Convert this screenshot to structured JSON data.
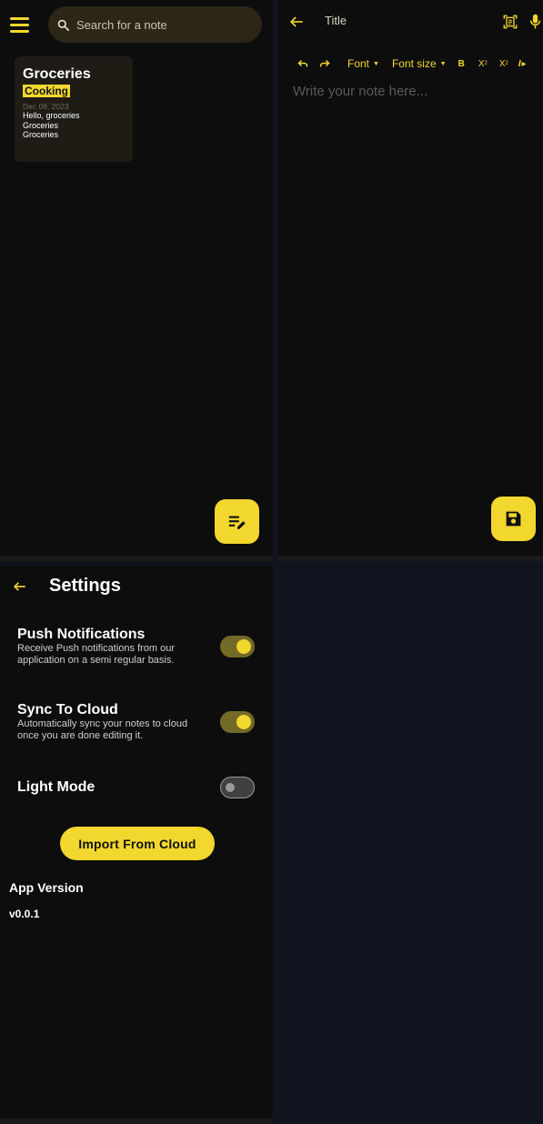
{
  "theme": {
    "accent": "#f2d72e",
    "background": "#0d0d0d",
    "card": "#1e1c15"
  },
  "notes_screen": {
    "search": {
      "placeholder": "Search for a note"
    },
    "notes": [
      {
        "title": "Groceries",
        "tag": "Cooking",
        "date": "Dec 08, 2023",
        "lines": [
          "Hello, groceries",
          "Groceries",
          "Groceries"
        ]
      }
    ],
    "fab_icon": "edit-note-icon"
  },
  "editor_screen": {
    "title_placeholder": "Title",
    "toolbar": {
      "undo_icon": "undo-icon",
      "redo_icon": "redo-icon",
      "font_label": "Font",
      "font_size_label": "Font size",
      "bold_label": "B",
      "subscript_label": "X",
      "superscript_label": "X",
      "italic_label": "I"
    },
    "body_placeholder": "Write your note here...",
    "fab_icon": "save-icon"
  },
  "settings_screen": {
    "title": "Settings",
    "items": [
      {
        "name": "Push Notifications",
        "description": "Receive Push notifications from our application on a semi regular basis.",
        "enabled": true
      },
      {
        "name": "Sync To Cloud",
        "description": "Automatically sync your notes to cloud once you are done editing it.",
        "enabled": true
      },
      {
        "name": "Light Mode",
        "description": "",
        "enabled": false
      }
    ],
    "import_button": "Import From Cloud",
    "app_version_label": "App Version",
    "app_version": "v0.0.1"
  }
}
